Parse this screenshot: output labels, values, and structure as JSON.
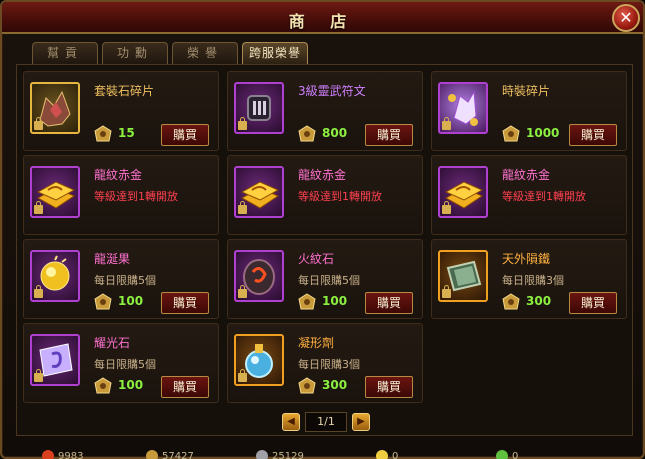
{
  "window": {
    "title": "商 店"
  },
  "tabs": [
    {
      "label": "幫貢",
      "active": false
    },
    {
      "label": "功勳",
      "active": false
    },
    {
      "label": "榮譽",
      "active": false
    },
    {
      "label": "跨服榮譽",
      "active": true
    }
  ],
  "items": [
    {
      "name": "套裝石碎片",
      "name_color": "gold",
      "price": "15",
      "buy_label": "購買"
    },
    {
      "name": "3級靈武符文",
      "name_color": "purple",
      "price": "800",
      "buy_label": "購買"
    },
    {
      "name": "時裝碎片",
      "name_color": "gold",
      "price": "1000",
      "buy_label": "購買"
    },
    {
      "name": "龍紋赤金",
      "name_color": "pink",
      "requirement": "等級達到1轉開放"
    },
    {
      "name": "龍紋赤金",
      "name_color": "pink",
      "requirement": "等級達到1轉開放"
    },
    {
      "name": "龍紋赤金",
      "name_color": "pink",
      "requirement": "等級達到1轉開放"
    },
    {
      "name": "龍涎果",
      "name_color": "pink",
      "limit": "每日限購5個",
      "price": "100",
      "buy_label": "購買"
    },
    {
      "name": "火紋石",
      "name_color": "pink",
      "limit": "每日限購5個",
      "price": "100",
      "buy_label": "購買"
    },
    {
      "name": "天外隕鐵",
      "name_color": "orange",
      "limit": "每日限購3個",
      "price": "300",
      "buy_label": "購買"
    },
    {
      "name": "耀光石",
      "name_color": "pink",
      "limit": "每日限購5個",
      "price": "100",
      "buy_label": "購買"
    },
    {
      "name": "凝形劑",
      "name_color": "orange",
      "limit": "每日限購3個",
      "price": "300",
      "buy_label": "購買"
    }
  ],
  "pagination": {
    "page_text": "1/1"
  },
  "currencies": [
    {
      "name": "gold-ingot",
      "value": "9983"
    },
    {
      "name": "contribution",
      "value": "57427"
    },
    {
      "name": "honor",
      "value": "25129"
    },
    {
      "name": "coin",
      "value": "0"
    },
    {
      "name": "cross-server-honor",
      "value": "0"
    }
  ],
  "colors": {
    "title_bar": "#4a0e0a",
    "price_green": "#8cf040",
    "requirement_red": "#ff4050",
    "rarity_purple": "#b040d0",
    "rarity_orange": "#f0a020"
  }
}
